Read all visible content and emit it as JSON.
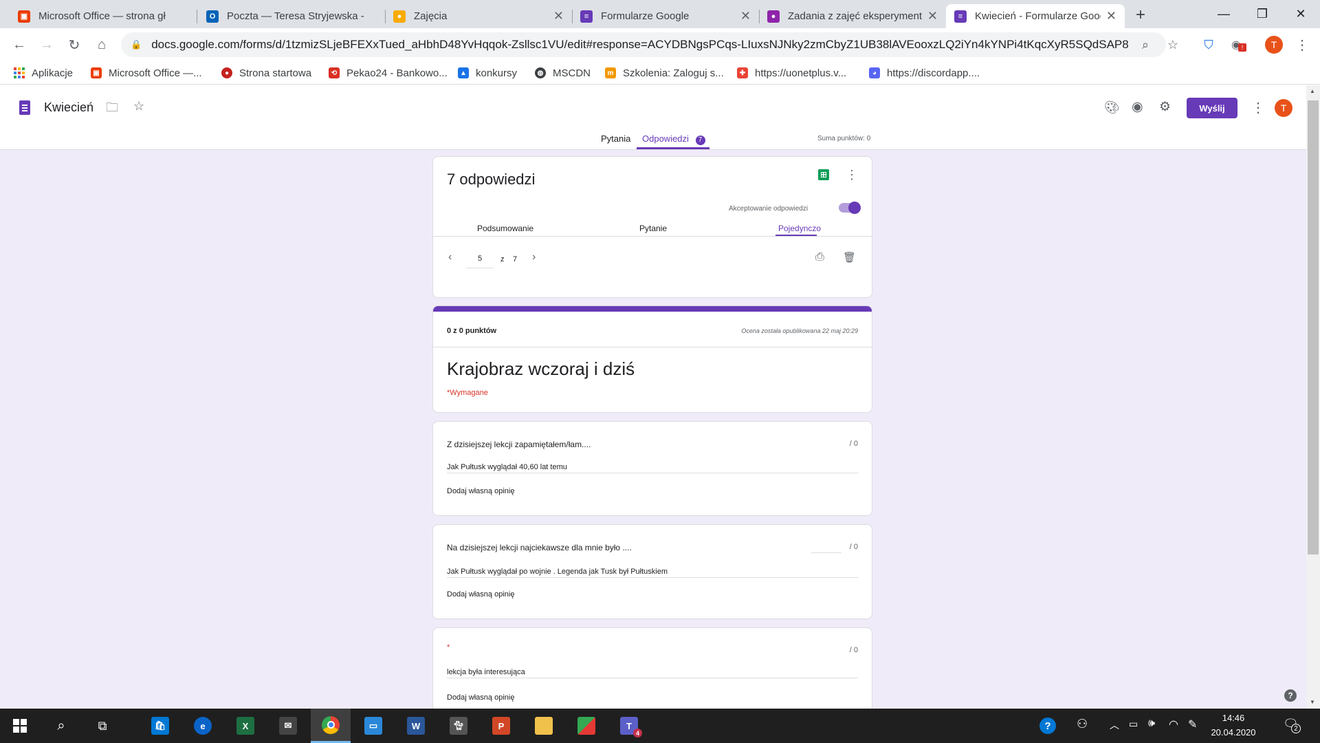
{
  "browser": {
    "tabs": [
      {
        "title": "Microsoft Office — strona gł",
        "icon": "office-icon",
        "color": "#eb3c00"
      },
      {
        "title": "Poczta — Teresa Stryjewska -",
        "icon": "outlook-icon",
        "color": "#0364b8"
      },
      {
        "title": "Zajęcia",
        "icon": "classroom-icon",
        "color": "#0f9d58"
      },
      {
        "title": "Formularze Google",
        "icon": "google-forms-icon",
        "color": "#673ab7"
      },
      {
        "title": "Zadania z zajęć eksperyment",
        "icon": "classroom-assignment-icon",
        "color": "#673ab7"
      },
      {
        "title": "Kwiecień - Formularze Googl",
        "icon": "google-forms-icon",
        "color": "#673ab7"
      }
    ],
    "new_tab": "+",
    "url": "docs.google.com/forms/d/1tzmizSLjeBFEXxTued_aHbhD48YvHqqok-Zsllsc1VU/edit#response=ACYDBNgsPCqs-LIuxsNJNky2zmCbyZ1UB38lAVEooxzLQ2iYn4kYNPi4tKqcXyR5SQdSAP8",
    "profile_initial": "T",
    "bookmarks": [
      {
        "label": "Aplikacje",
        "icon": "apps-grid-icon",
        "color": "#ea4335"
      },
      {
        "label": "Microsoft Office —...",
        "icon": "office-icon",
        "color": "#eb3c00"
      },
      {
        "label": "Strona startowa",
        "icon": "start-page-icon",
        "color": "#c5221f"
      },
      {
        "label": "Pekao24 - Bankowo...",
        "icon": "pekao-icon",
        "color": "#d93025"
      },
      {
        "label": "konkursy",
        "icon": "konkursy-icon",
        "color": "#1a73e8"
      },
      {
        "label": "MSCDN",
        "icon": "globe-icon",
        "color": "#3c4043"
      },
      {
        "label": "Szkolenia: Zaloguj s...",
        "icon": "moodle-icon",
        "color": "#f29900"
      },
      {
        "label": "https://uonetplus.v...",
        "icon": "uonet-icon",
        "color": "#ea4335"
      },
      {
        "label": "https://discordapp....",
        "icon": "discord-icon",
        "color": "#5865f2"
      }
    ]
  },
  "form": {
    "title": "Kwiecień",
    "send_label": "Wyślij",
    "tabs": {
      "questions": "Pytania",
      "responses": "Odpowiedzi",
      "responses_count": "7"
    },
    "total_points": "Suma punktów: 0",
    "summary": {
      "count_title": "7 odpowiedzi",
      "accepting_label": "Akceptowanie odpowiedzi",
      "subtabs": [
        "Podsumowanie",
        "Pytanie",
        "Pojedynczo"
      ],
      "pager_current": "5",
      "pager_of": "z",
      "pager_total": "7"
    },
    "response": {
      "score": "0 z 0 punktów",
      "published": "Ocena została opublikowana 22 maj 20:29",
      "form_name": "Krajobraz wczoraj i dziś",
      "required": "*Wymagane",
      "questions": [
        {
          "title": "Z dzisiejszej lekcji zapamiętałem/łam....",
          "points": "/ 0",
          "answer": "Jak Pułtusk wyglądał 40,60 lat temu",
          "feedback": "Dodaj własną opinię"
        },
        {
          "title": "Na dzisiejszej lekcji najciekawsze dla mnie było ....",
          "points": "/ 0",
          "answer": "Jak Pułtusk wyglądał po wojnie . Legenda jak Tusk był Pułtuskiem",
          "feedback": "Dodaj własną opinię"
        },
        {
          "title": "*",
          "points": "/ 0",
          "answer": "lekcja była interesująca",
          "feedback": "Dodaj własną opinię"
        }
      ]
    }
  },
  "taskbar": {
    "apps": [
      {
        "name": "store",
        "label": "",
        "color": "#0078d4"
      },
      {
        "name": "edge",
        "label": "e",
        "color": "#0a64c8"
      },
      {
        "name": "excel",
        "label": "X",
        "color": "#1d6f42"
      },
      {
        "name": "mail",
        "label": "",
        "color": "#444"
      },
      {
        "name": "chrome",
        "label": "",
        "color": "#dd4b39"
      },
      {
        "name": "remote-desktop",
        "label": "",
        "color": "#2b88d8"
      },
      {
        "name": "word",
        "label": "W",
        "color": "#2b579a"
      },
      {
        "name": "cat-app",
        "label": "",
        "color": "#555"
      },
      {
        "name": "powerpoint",
        "label": "P",
        "color": "#d24726"
      },
      {
        "name": "file-explorer",
        "label": "",
        "color": "#f0c14b"
      },
      {
        "name": "prezi",
        "label": "",
        "color": "#e53935"
      },
      {
        "name": "teams",
        "label": "T",
        "color": "#5b5fc7"
      }
    ],
    "teams_badge": "4",
    "time": "14:46",
    "date": "20.04.2020",
    "notification_count": "2"
  }
}
